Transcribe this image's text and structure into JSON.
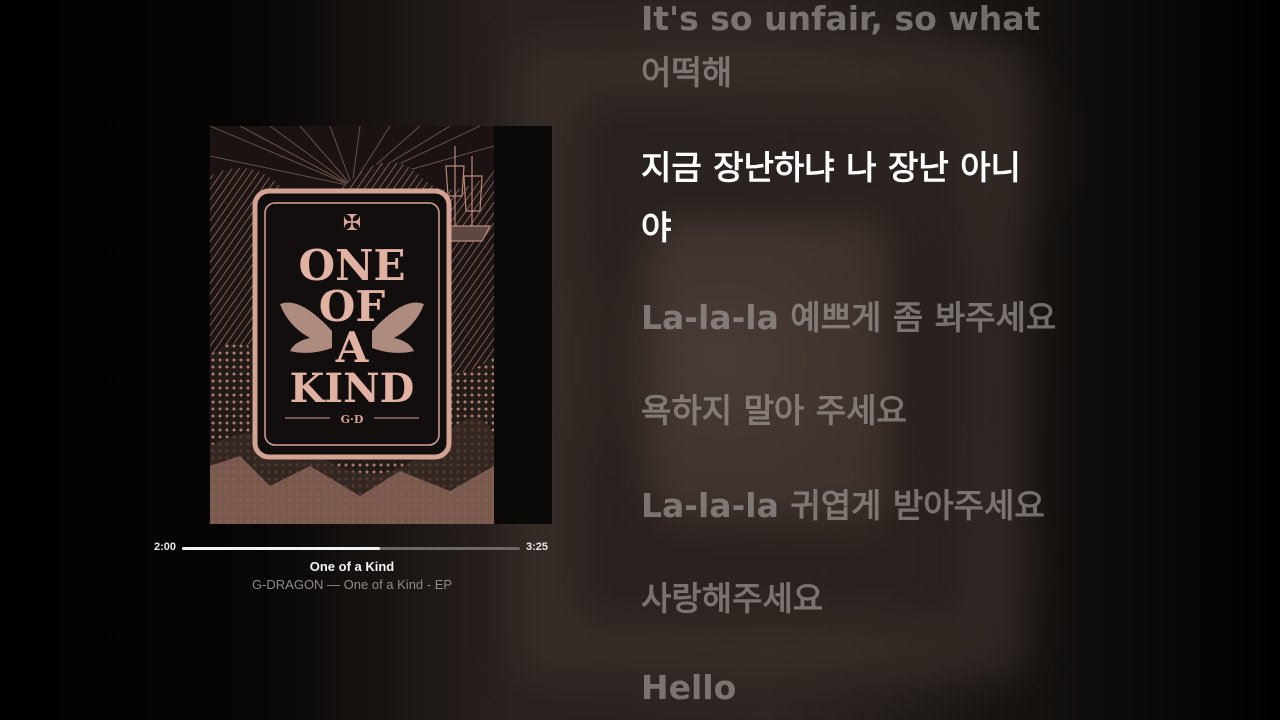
{
  "player": {
    "elapsed": "2:00",
    "duration": "3:25",
    "progress": 0.585,
    "title": "One of a Kind",
    "subtitle": "G-DRAGON — One of a Kind - EP"
  },
  "album": {
    "line1": "ONE",
    "line2": "OF",
    "line3": "A",
    "line4": "KIND",
    "monogram": "G·D",
    "cross": "✠",
    "accent_color": "#c9968a"
  },
  "lyrics": [
    {
      "text": "It's so unfair, so what",
      "active": false
    },
    {
      "text": "어떡해",
      "active": false
    },
    {
      "text": "지금 장난하냐 나 장난 아니",
      "active": true
    },
    {
      "text": "야",
      "active": true
    },
    {
      "text": "La-la-la 예쁘게 좀 봐주세요",
      "active": false
    },
    {
      "text": "욕하지 말아 주세요",
      "active": false
    },
    {
      "text": "La-la-la 귀엽게 받아주세요",
      "active": false
    },
    {
      "text": "사랑해주세요",
      "active": false
    },
    {
      "text": "Hello",
      "active": false
    }
  ]
}
